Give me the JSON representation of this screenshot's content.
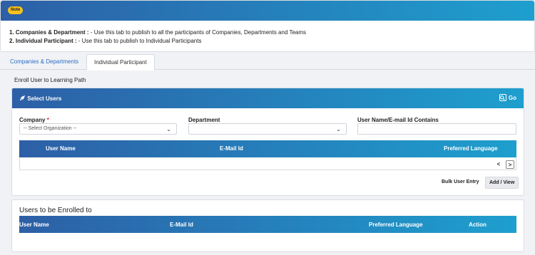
{
  "note": {
    "badge": "Note",
    "line1_label": "1. Companies & Department :",
    "line1_text": " - Use this tab to publish to all the participants of Companies, Departments and Teams",
    "line2_label": "2. Individual Participant :",
    "line2_text": " - Use this tab to publish to Individual Participants"
  },
  "tabs": [
    {
      "label": "Companies & Departments"
    },
    {
      "label": "Individual Participant",
      "active": true
    }
  ],
  "enroll_title": "Enroll User to Learning Path",
  "select_users": {
    "title": "Select Users",
    "title_icon": "rocket-icon",
    "go_label": "Go",
    "go_icon": "search-icon",
    "company_label": "Company",
    "company_required_mark": "*",
    "company_value": "-- Select Organization --",
    "department_label": "Department",
    "department_value": "",
    "username_label": "User Name/E-mail Id Contains",
    "username_value": "",
    "columns": [
      "User Name",
      "E-Mail Id",
      "Preferred Language"
    ],
    "pager_prev": "<",
    "pager_next": ">",
    "bulk_label": "Bulk User Entry",
    "add_view_label": "Add / View"
  },
  "enrolled": {
    "title": "Users to be Enrolled to",
    "columns": [
      "User Name",
      "E-Mail Id",
      "Preferred Language",
      "Action"
    ]
  },
  "colors": {
    "header_gradient_start": "#2d5fa6",
    "header_gradient_end": "#1e9fce",
    "badge": "#f6c11c",
    "required": "#e0243a",
    "link_tab": "#2a6cc6"
  }
}
